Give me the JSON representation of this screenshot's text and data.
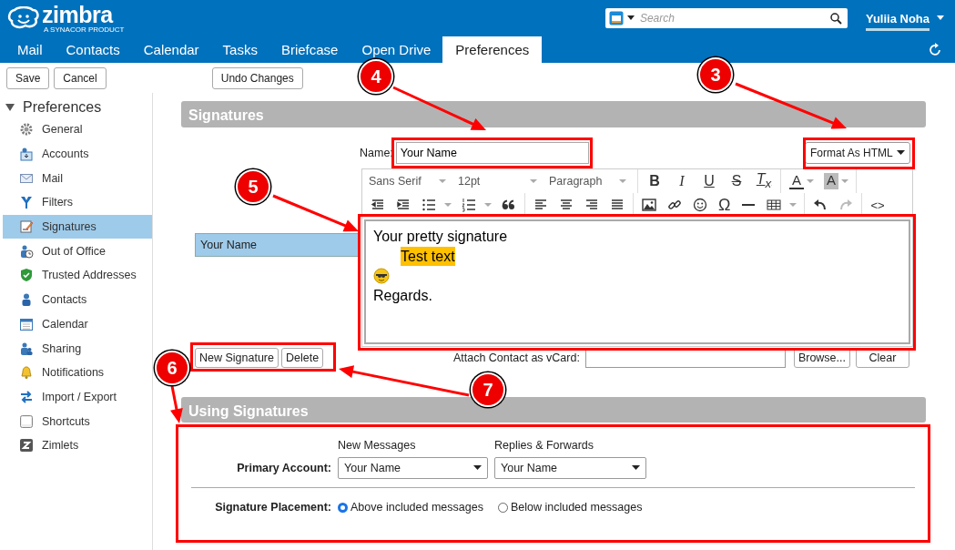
{
  "header": {
    "logo": "zimbra",
    "logo_tagline": "A SYNACOR PRODUCT",
    "search": {
      "placeholder": "Search"
    },
    "user": "Yuliia Noha"
  },
  "tabs": [
    {
      "label": "Mail",
      "selected": false
    },
    {
      "label": "Contacts",
      "selected": false
    },
    {
      "label": "Calendar",
      "selected": false
    },
    {
      "label": "Tasks",
      "selected": false
    },
    {
      "label": "Briefcase",
      "selected": false
    },
    {
      "label": "Open Drive",
      "selected": false
    },
    {
      "label": "Preferences",
      "selected": true
    }
  ],
  "toolbar": {
    "buttons": [
      "Save",
      "Cancel"
    ],
    "undo": "Undo Changes"
  },
  "sidebar": {
    "title": "Preferences",
    "expanded": true,
    "items": [
      {
        "label": "General",
        "selected": false
      },
      {
        "label": "Accounts",
        "selected": false
      },
      {
        "label": "Mail",
        "selected": false
      },
      {
        "label": "Filters",
        "selected": false
      },
      {
        "label": "Signatures",
        "selected": true
      },
      {
        "label": "Out of Office",
        "selected": false
      },
      {
        "label": "Trusted Addresses",
        "selected": false
      },
      {
        "label": "Contacts",
        "selected": false
      },
      {
        "label": "Calendar",
        "selected": false
      },
      {
        "label": "Sharing",
        "selected": false
      },
      {
        "label": "Notifications",
        "selected": false
      },
      {
        "label": "Import / Export",
        "selected": false
      },
      {
        "label": "Shortcuts",
        "selected": false
      },
      {
        "label": "Zimlets",
        "selected": false
      }
    ]
  },
  "signatures": {
    "title": "Signatures",
    "list": [
      {
        "label": "Your Name",
        "selected": true
      }
    ],
    "name_label": "Name:",
    "name_value": "Your Name",
    "format": "Format As HTML",
    "editor": {
      "font": "Sans Serif",
      "size": "12pt",
      "block": "Paragraph",
      "format_buttons": [
        "B",
        "I",
        "U",
        "S",
        "T$_{x}$"
      ],
      "color_buttons": [
        "A",
        "A"
      ],
      "symbol": "Ω",
      "code": "<>",
      "lines": [
        {
          "kind": "plain",
          "text": "Your pretty signature"
        },
        {
          "kind": "highlight",
          "text": "Test text"
        },
        {
          "kind": "emoji"
        },
        {
          "kind": "plain",
          "text": "Regards."
        }
      ]
    },
    "buttons": [
      "New Signature",
      "Delete"
    ],
    "vcard_label": "Attach Contact as vCard:",
    "vcard_buttons": [
      "Browse...",
      "Clear"
    ]
  },
  "using": {
    "title": "Using Signatures",
    "columns": [
      "New Messages",
      "Replies & Forwards"
    ],
    "account_label": "Primary Account:",
    "account_values": [
      "Your Name",
      "Your Name"
    ],
    "placement_label": "Signature Placement:",
    "placement_options": [
      {
        "label": "Above included messages",
        "selected": true
      },
      {
        "label": "Below included messages",
        "selected": false
      }
    ]
  },
  "annotations": [
    {
      "number": "4"
    },
    {
      "number": "3"
    },
    {
      "number": "5"
    },
    {
      "number": "6"
    },
    {
      "number": "7"
    }
  ]
}
